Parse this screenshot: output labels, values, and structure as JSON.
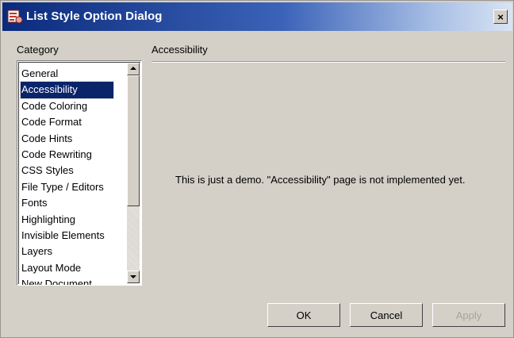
{
  "window": {
    "title": "List Style Option Dialog"
  },
  "titlebar": {
    "close_glyph": "×",
    "icon": "app-icon"
  },
  "sidebar": {
    "label": "Category",
    "items": [
      {
        "label": "General",
        "selected": false
      },
      {
        "label": "Accessibility",
        "selected": true
      },
      {
        "label": "Code Coloring",
        "selected": false
      },
      {
        "label": "Code Format",
        "selected": false
      },
      {
        "label": "Code Hints",
        "selected": false
      },
      {
        "label": "Code Rewriting",
        "selected": false
      },
      {
        "label": "CSS Styles",
        "selected": false
      },
      {
        "label": "File Type / Editors",
        "selected": false
      },
      {
        "label": "Fonts",
        "selected": false
      },
      {
        "label": "Highlighting",
        "selected": false
      },
      {
        "label": "Invisible Elements",
        "selected": false
      },
      {
        "label": "Layers",
        "selected": false
      },
      {
        "label": "Layout Mode",
        "selected": false
      },
      {
        "label": "New Document",
        "selected": false
      }
    ]
  },
  "main": {
    "title": "Accessibility",
    "message": "This is just a demo. \"Accessibility\" page is not implemented yet."
  },
  "buttons": {
    "ok": "OK",
    "cancel": "Cancel",
    "apply": "Apply",
    "apply_enabled": false
  },
  "colors": {
    "selection": "#0a246a",
    "dialog_bg": "#d4d0c8",
    "title_gradient_start": "#0b2a7c"
  }
}
